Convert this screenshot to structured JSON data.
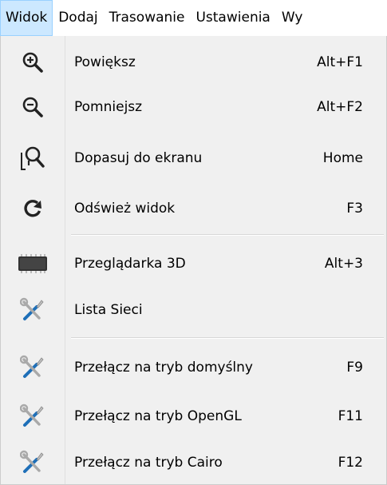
{
  "menubar": {
    "items": [
      {
        "label": "Widok"
      },
      {
        "label": "Dodaj"
      },
      {
        "label": "Trasowanie"
      },
      {
        "label": "Ustawienia"
      },
      {
        "label": "Wy"
      }
    ]
  },
  "menu": {
    "items": [
      {
        "label": "Powiększ",
        "shortcut": "Alt+F1",
        "icon": "zoom-in-icon"
      },
      {
        "label": "Pomniejsz",
        "shortcut": "Alt+F2",
        "icon": "zoom-out-icon"
      },
      {
        "label": "Dopasuj do ekranu",
        "shortcut": "Home",
        "icon": "zoom-fit-icon"
      },
      {
        "label": "Odśwież widok",
        "shortcut": "F3",
        "icon": "refresh-icon"
      },
      {
        "label": "Przeglądarka 3D",
        "shortcut": "Alt+3",
        "icon": "chip-3d-icon"
      },
      {
        "label": "Lista Sieci",
        "shortcut": "",
        "icon": "tools-icon"
      },
      {
        "label": "Przełącz na tryb domyślny",
        "shortcut": "F9",
        "icon": "tools-icon"
      },
      {
        "label": "Przełącz na tryb OpenGL",
        "shortcut": "F11",
        "icon": "tools-icon"
      },
      {
        "label": "Przełącz na tryb Cairo",
        "shortcut": "F12",
        "icon": "tools-icon"
      }
    ]
  },
  "colors": {
    "menubar_active_bg": "#cce8ff",
    "menubar_active_border": "#99d1ff",
    "dropdown_bg": "#f0f0f0"
  }
}
